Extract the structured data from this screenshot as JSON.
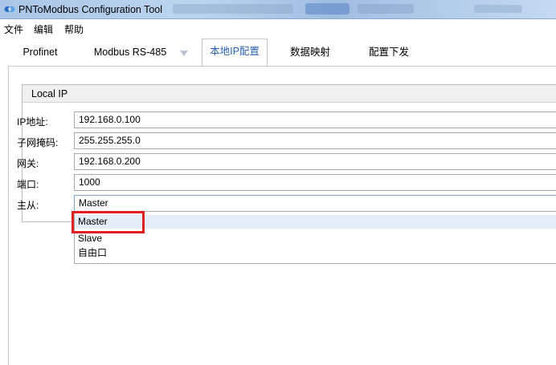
{
  "window": {
    "title": "PNToModbus Configuration Tool",
    "icon": "app-logo-icon"
  },
  "menu": [
    "文件",
    "编辑",
    "帮助"
  ],
  "tabs": [
    {
      "label": "Profinet"
    },
    {
      "label": "Modbus RS-485"
    },
    {
      "label": "本地IP配置",
      "active": true
    },
    {
      "label": "数据映射"
    },
    {
      "label": "配置下发"
    }
  ],
  "group": {
    "title": "Local IP",
    "fields": [
      {
        "label": "IP地址:",
        "value": "192.168.0.100"
      },
      {
        "label": "子网掩码:",
        "value": "255.255.255.0"
      },
      {
        "label": "网关:",
        "value": "192.168.0.200"
      },
      {
        "label": "端口:",
        "value": "1000"
      }
    ],
    "role_label": "主从:",
    "role_value": "Master"
  },
  "dropdown": {
    "options": [
      "Master",
      "Slave",
      "自由口"
    ],
    "selected_index": 0
  },
  "colors": {
    "active_tab_text": "#2a5fb0",
    "highlight": "#e02020",
    "selected_option": "#e4edf8"
  }
}
